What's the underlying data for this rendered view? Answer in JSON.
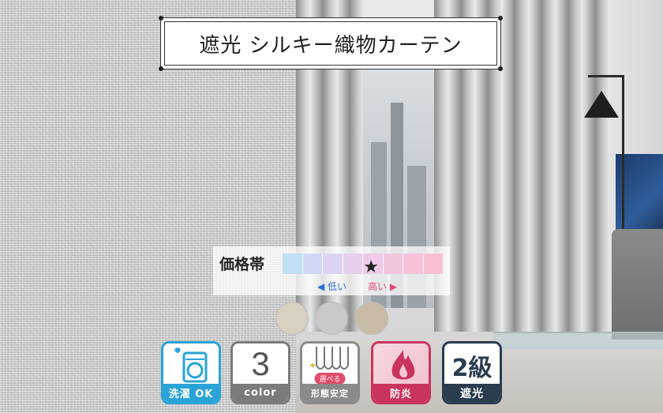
{
  "title": "遮光 シルキー織物カーテン",
  "price_band": {
    "label": "価格帯",
    "low_label": "◀ 低い",
    "high_label": "高い ▶",
    "star": "★",
    "level": 0.55,
    "cells": [
      "#bfe0f7",
      "#cfd9f6",
      "#dcd4f3",
      "#e7cfee",
      "#efcbe7",
      "#f3c6df",
      "#f6c2d8",
      "#f8bed1"
    ]
  },
  "swatches": [
    {
      "name": "beige",
      "color": "#d8d0c0"
    },
    {
      "name": "gray",
      "color": "#c9c9c9"
    },
    {
      "name": "khaki",
      "color": "#c8bca6"
    }
  ],
  "features": {
    "wash": {
      "caption": "洗濯 OK",
      "icon": "washing-machine-icon"
    },
    "color": {
      "number": "3",
      "caption": "color"
    },
    "form": {
      "badge": "選べる",
      "caption": "形態安定",
      "icon": "pleats-icon"
    },
    "fire": {
      "caption": "防炎",
      "icon": "flame-icon"
    },
    "grade": {
      "number": "2級",
      "caption": "遮光"
    }
  }
}
